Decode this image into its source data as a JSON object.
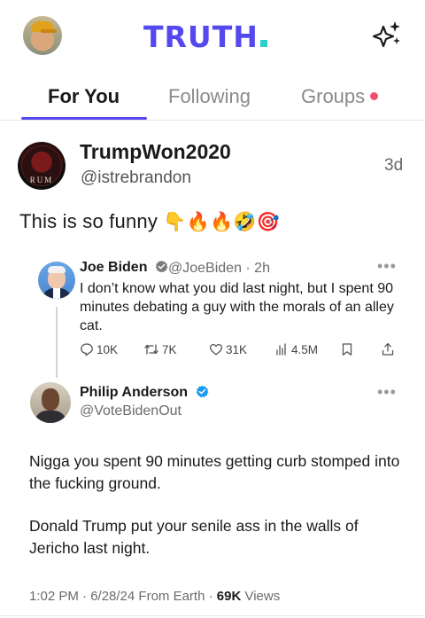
{
  "header": {
    "logo_text": "TRUTH",
    "logo_color": "#5448ee",
    "logo_dot_color": "#2ad1c9",
    "left_icon": "profile-avatar",
    "right_icon": "sparkle-icon"
  },
  "tabs": [
    {
      "label": "For You",
      "active": true
    },
    {
      "label": "Following",
      "active": false
    },
    {
      "label": "Groups",
      "active": false,
      "has_notification_dot": true
    }
  ],
  "post": {
    "display_name": "TrumpWon2020",
    "handle": "@istrebrandon",
    "time_ago": "3d",
    "avatar_text": "RUM",
    "text": "This is so funny",
    "emojis": "👇🔥🔥🤣🎯"
  },
  "embedded": {
    "original": {
      "name": "Joe Biden",
      "verified": true,
      "meta": "@JoeBiden · 2h",
      "text": "I don’t know what you did last night, but I spent 90 minutes debating a guy with the morals of an alley cat.",
      "replies": "10K",
      "reposts": "7K",
      "likes": "31K",
      "views": "4.5M"
    },
    "reply": {
      "name": "Philip Anderson",
      "verified": true,
      "handle": "@VoteBidenOut",
      "paragraph1": "Nigga you spent 90 minutes getting curb stomped into the fucking ground.",
      "paragraph2": "Donald Trump put your senile ass in the walls of Jericho last night.",
      "timestamp": "1:02 PM · 6/28/24 From Earth · ",
      "views_count": "69K",
      "views_label": " Views"
    },
    "more_icon": "more-dots-icon"
  }
}
